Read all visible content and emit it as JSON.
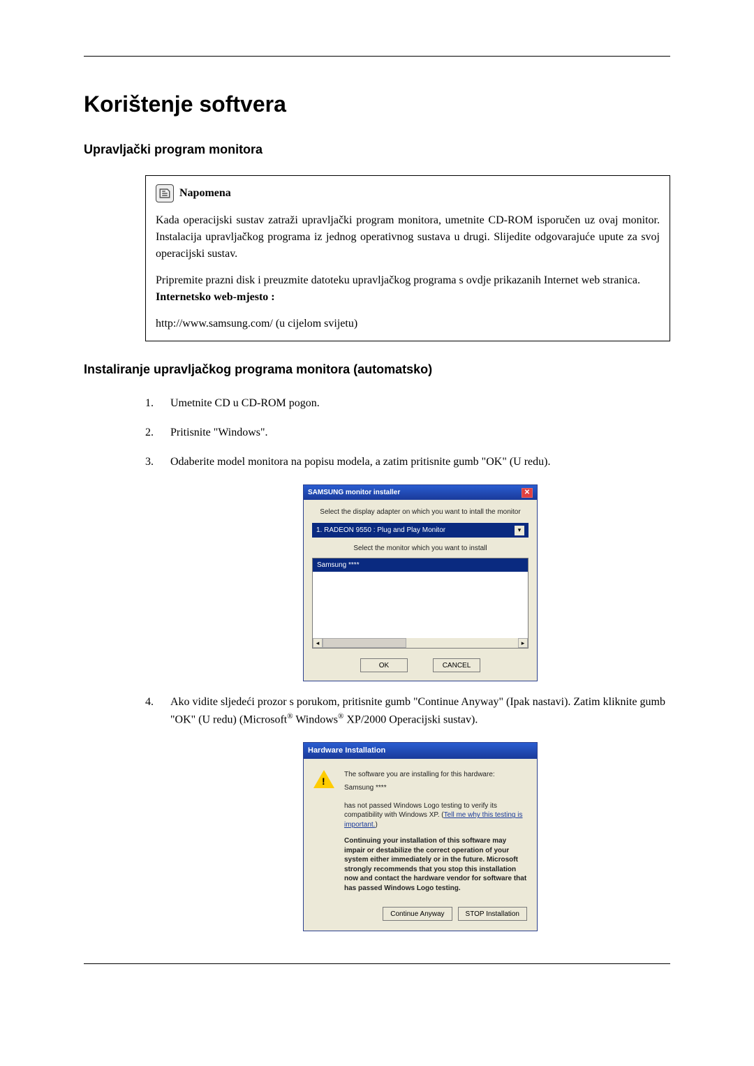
{
  "page": {
    "main_title": "Korištenje softvera",
    "section1_title": "Upravljački program monitora",
    "section2_title": "Instaliranje upravljačkog programa monitora (automatsko)"
  },
  "note": {
    "label": "Napomena",
    "paragraph1": "Kada operacijski sustav zatraži upravljački program monitora, umetnite CD-ROM isporučen uz ovaj monitor. Instalacija upravljačkog programa iz jednog operativnog sustava u drugi. Slijedite odgovarajuće upute za svoj operacijski sustav.",
    "paragraph2": "Pripremite prazni disk i preuzmite datoteku upravljačkog programa s ovdje prikazanih Internet web stranica.",
    "link_label": "Internetsko web-mjesto :",
    "url": "http://www.samsung.com/ (u cijelom svijetu)"
  },
  "steps": {
    "s1": "Umetnite CD u CD-ROM pogon.",
    "s2": "Pritisnite \"Windows\".",
    "s3": "Odaberite model monitora na popisu modela, a zatim pritisnite gumb \"OK\" (U redu).",
    "s4_pre": "Ako vidite sljedeći prozor s porukom, pritisnite gumb \"Continue Anyway\" (Ipak nastavi). Zatim kliknite gumb \"OK\" (U redu) (Microsoft",
    "s4_mid": " Windows",
    "s4_post": " XP/2000 Operacijski sustav).",
    "reg": "®"
  },
  "dialog1": {
    "title": "SAMSUNG monitor installer",
    "instruction1": "Select the display adapter on which you want to intall the monitor",
    "combo_value": "1.  RADEON 9550 : Plug and Play Monitor",
    "instruction2": "Select the monitor which you want to install",
    "list_selected": "Samsung ****",
    "ok": "OK",
    "cancel": "CANCEL"
  },
  "dialog2": {
    "title": "Hardware Installation",
    "p1": "The software you are installing for this hardware:",
    "pname": "Samsung ****",
    "p2a": "has not passed Windows Logo testing to verify its compatibility with Windows XP. (",
    "p2link": "Tell me why this testing is important.",
    "p2b": ")",
    "p3": "Continuing your installation of this software may impair or destabilize the correct operation of your system either immediately or in the future. Microsoft strongly recommends that you stop this installation now and contact the hardware vendor for software that has passed Windows Logo testing.",
    "continue": "Continue Anyway",
    "stop": "STOP Installation"
  }
}
